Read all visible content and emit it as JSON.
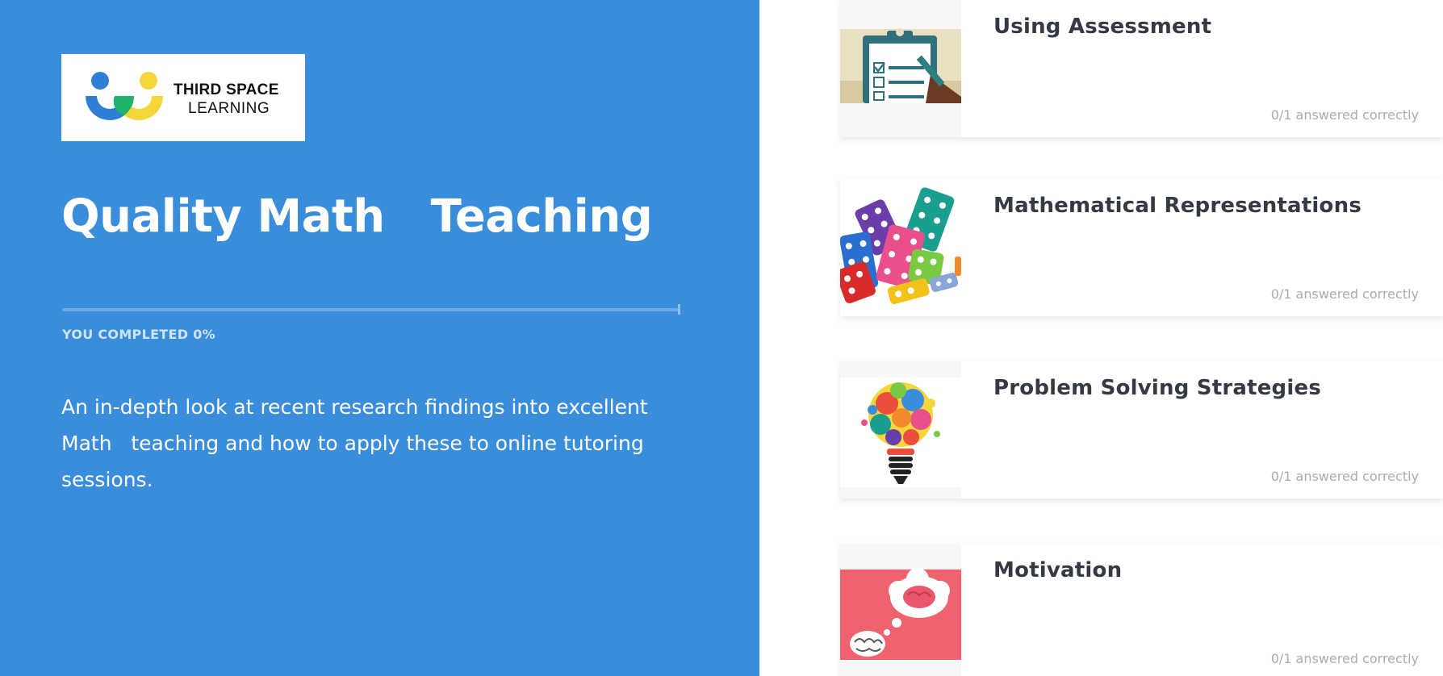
{
  "logo": {
    "line1": "THIRD SPACE",
    "line2": "LEARNING",
    "icon": "third-space-learning-logo",
    "colors": {
      "blue": "#2f7fd6",
      "green": "#1fb36b",
      "yellow": "#f5d63a"
    }
  },
  "course": {
    "title": "Quality Math   Teaching",
    "progress_percent": 0,
    "progress_label": "YOU COMPLETED 0%",
    "description": "An in-depth look at recent research findings into excellent Math   teaching and how to apply these to online tutoring sessions."
  },
  "modules": [
    {
      "title": "Using Assessment",
      "status": "0/1 answered correctly",
      "thumbnail": "clipboard-checklist-icon"
    },
    {
      "title": "Mathematical Representations",
      "status": "0/1 answered correctly",
      "thumbnail": "counting-blocks-icon"
    },
    {
      "title": "Problem Solving Strategies",
      "status": "0/1 answered correctly",
      "thumbnail": "puzzle-lightbulb-icon"
    },
    {
      "title": "Motivation",
      "status": "0/1 answered correctly",
      "thumbnail": "brain-thought-bubble-icon"
    }
  ],
  "colors": {
    "left_panel_bg": "#3a8ddb",
    "card_title": "#333a44",
    "card_status": "#a8acb1"
  }
}
